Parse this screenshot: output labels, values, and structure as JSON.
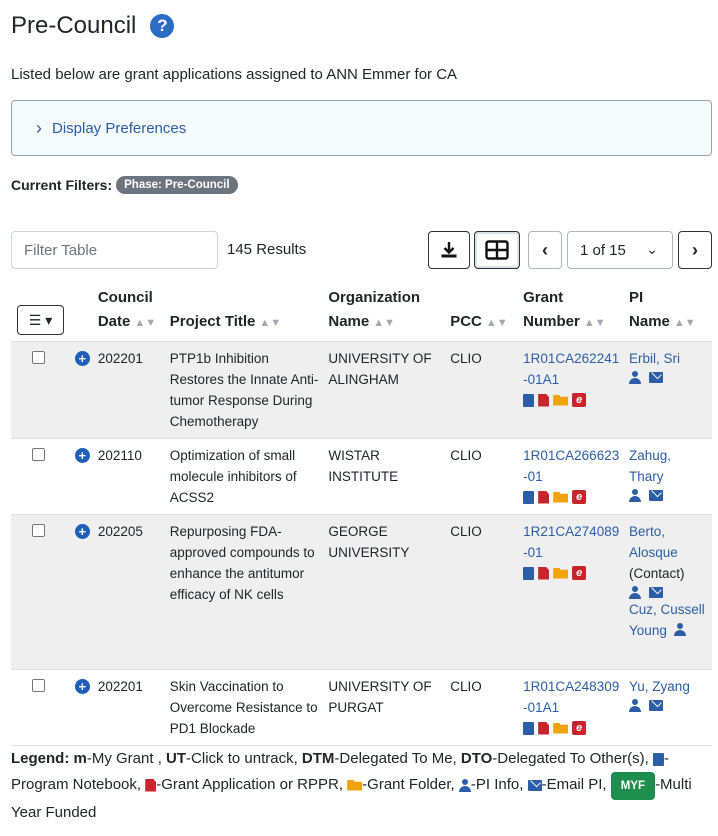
{
  "page": {
    "title": "Pre-Council",
    "subtitle": "Listed below are grant applications assigned to ANN Emmer for CA"
  },
  "display_preferences": {
    "label": "Display Preferences"
  },
  "filters": {
    "label": "Current Filters:",
    "badge": "Phase: Pre-Council"
  },
  "toolbar": {
    "filter_placeholder": "Filter Table",
    "results": "145 Results",
    "page_select": "1 of 15"
  },
  "table": {
    "headers": {
      "council_date": "Council Date",
      "project_title": "Project Title",
      "organization_name": "Organization Name",
      "pcc": "PCC",
      "grant_number": "Grant Number",
      "pi_name": "PI Name"
    },
    "rows": [
      {
        "council_date": "202201",
        "project_title": "PTP1b Inhibition Restores the Innate Anti-tumor Response During Chemotherapy",
        "organization": "UNIVERSITY OF ALINGHAM",
        "pcc": "CLIO",
        "grant_number": "1R01CA262241-01A1",
        "pi": "Erbil, Sri"
      },
      {
        "council_date": "202110",
        "project_title": "Optimization of small molecule inhibitors of ACSS2",
        "organization": "WISTAR INSTITUTE",
        "pcc": "CLIO",
        "grant_number": "1R01CA266623-01",
        "pi": "Zahug, Thary"
      },
      {
        "council_date": "202205",
        "project_title": "Repurposing FDA-approved compounds to enhance the antitumor efficacy of NK cells",
        "organization": "GEORGE UNIVERSITY",
        "pcc": "CLIO",
        "grant_number": "1R21CA274089-01",
        "pi": "Berto, Alosque",
        "pi_role": "(Contact)",
        "pi2": "Cuz, Cussell Young"
      },
      {
        "council_date": "202201",
        "project_title": "Skin Vaccination to Overcome Resistance to PD1 Blockade",
        "organization": "UNIVERSITY OF PURGAT",
        "pcc": "CLIO",
        "grant_number": "1R01CA248309-01A1",
        "pi": "Yu, Zyang"
      }
    ]
  },
  "legend": {
    "label": "Legend:",
    "m_key": "m",
    "m_text": "-My Grant ,",
    "ut_key": "UT",
    "ut_text": "-Click to untrack,",
    "dtm_key": "DTM",
    "dtm_text": "-Delegated To Me,",
    "dto_key": "DTO",
    "dto_text": "-Delegated To Other(s),",
    "notebook_text": "-Program Notebook,",
    "pdf_text": "-Grant Application or RPPR,",
    "folder_text": "-Grant Folder,",
    "pi_text": "-PI Info,",
    "email_text": "-Email PI,",
    "myf_badge": "MYF",
    "myf_text": "-Multi Year Funded"
  }
}
